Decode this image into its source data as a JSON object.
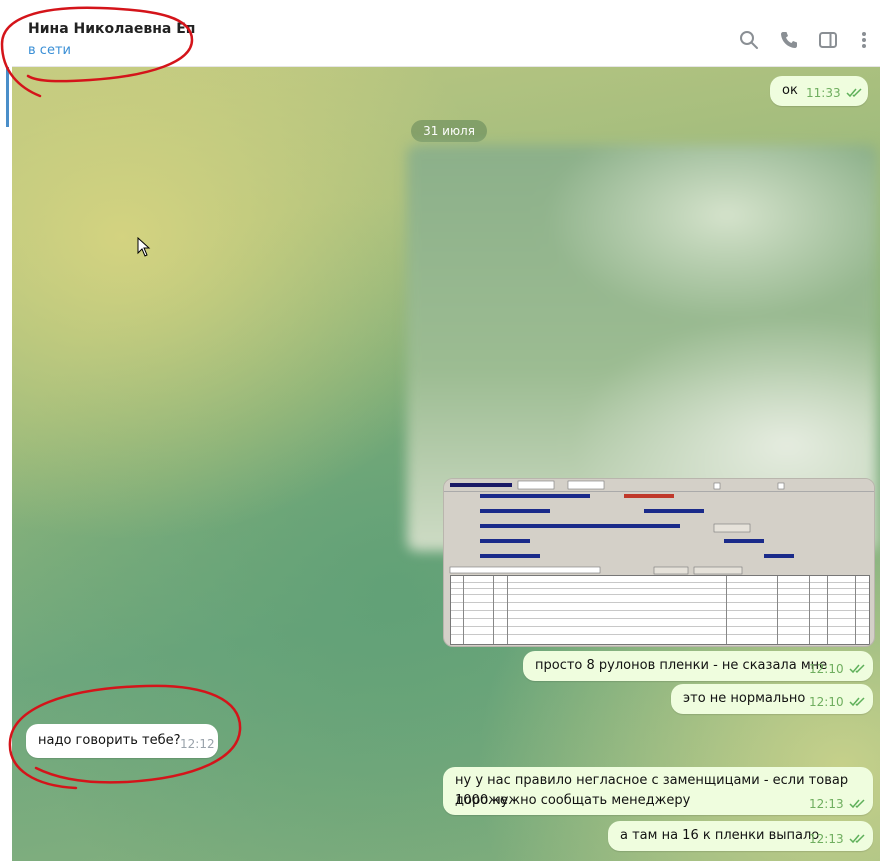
{
  "header": {
    "contact_name": "Нина Николаевна Еп",
    "status": "в сети",
    "icons": [
      "search-icon",
      "phone-icon",
      "sidebar-toggle-icon",
      "more-vertical-icon"
    ]
  },
  "chat": {
    "date_separator": "31 июля",
    "messages": [
      {
        "direction": "out",
        "text": "ок",
        "time": "11:33",
        "status": "read"
      },
      {
        "direction": "out",
        "type": "photo",
        "content": "blurred-image"
      },
      {
        "direction": "out",
        "type": "photo",
        "content": "program-screenshot"
      },
      {
        "direction": "out",
        "text": "просто 8 рулонов пленки - не сказала мне",
        "time": "12:10",
        "status": "read"
      },
      {
        "direction": "out",
        "text": "это не нормально",
        "time": "12:10",
        "status": "read"
      },
      {
        "direction": "in",
        "text": "надо говорить тебе?",
        "time": "12:12"
      },
      {
        "direction": "out",
        "text_line1": "ну у нас правило негласное с заменщицами - если товар дороже",
        "text_line2": "1000 нужно сообщать менеджеру",
        "time": "12:13",
        "status": "read"
      },
      {
        "direction": "out",
        "text": "а там на 16 к пленки выпало",
        "time": "12:13",
        "status": "read"
      }
    ]
  },
  "colors": {
    "outgoing_bubble": "#effdde",
    "incoming_bubble": "#ffffff",
    "read_ticks": "#5fb05a",
    "status_online": "#3a8fd6",
    "annotation_red": "#d4141a"
  }
}
